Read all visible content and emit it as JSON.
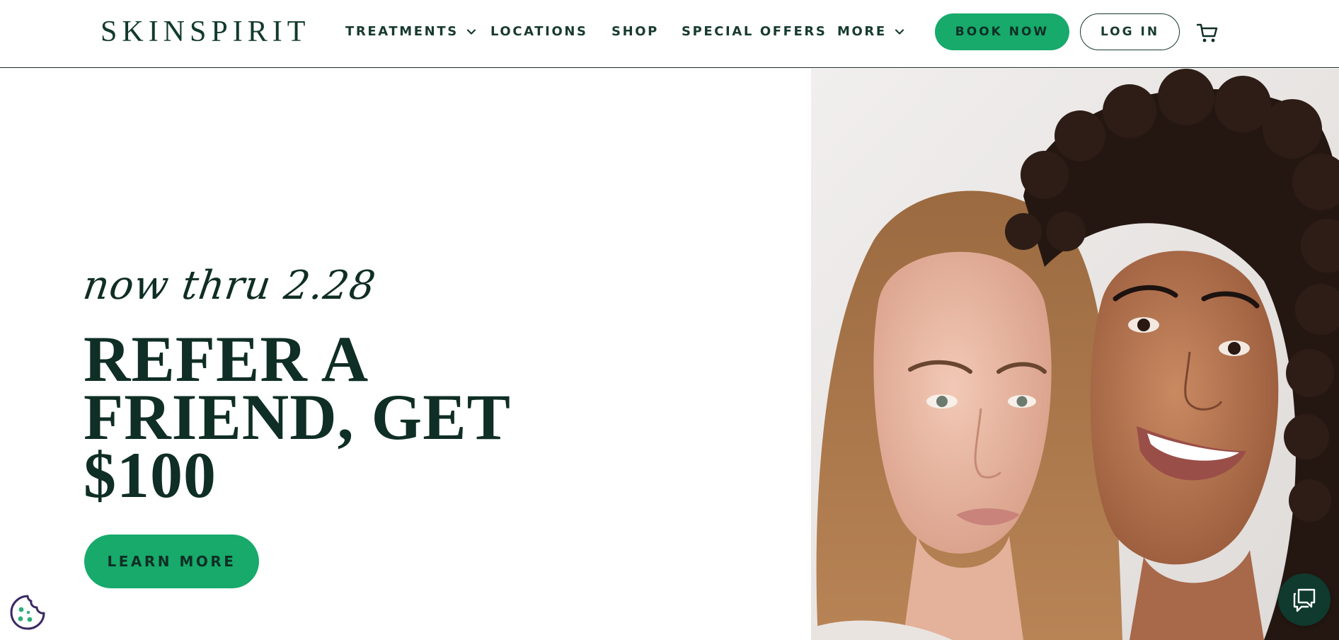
{
  "header": {
    "logo": "SKINSPIRIT",
    "nav": [
      {
        "label": "TREATMENTS",
        "has_dropdown": true
      },
      {
        "label": "LOCATIONS",
        "has_dropdown": false
      },
      {
        "label": "SHOP",
        "has_dropdown": false
      },
      {
        "label": "SPECIAL OFFERS",
        "has_dropdown": false
      },
      {
        "label": "MORE",
        "has_dropdown": true
      }
    ],
    "book_button": "BOOK NOW",
    "login_button": "LOG IN",
    "cart_icon": "shopping-cart-icon"
  },
  "hero": {
    "script_text": "now thru 2.28",
    "headline_lines": [
      "REFER A",
      "FRIEND, GET",
      "$100"
    ],
    "cta": "LEARN MORE",
    "image": "two-women-smiling-photo"
  },
  "widgets": {
    "cookie_icon": "cookie-icon",
    "chat_icon": "chat-bubbles-icon"
  },
  "colors": {
    "brand_green": "#17aa6b",
    "dark_green": "#0f2e25",
    "chat_bg": "#0f3a2d",
    "cookie_outline": "#3b2a63"
  }
}
